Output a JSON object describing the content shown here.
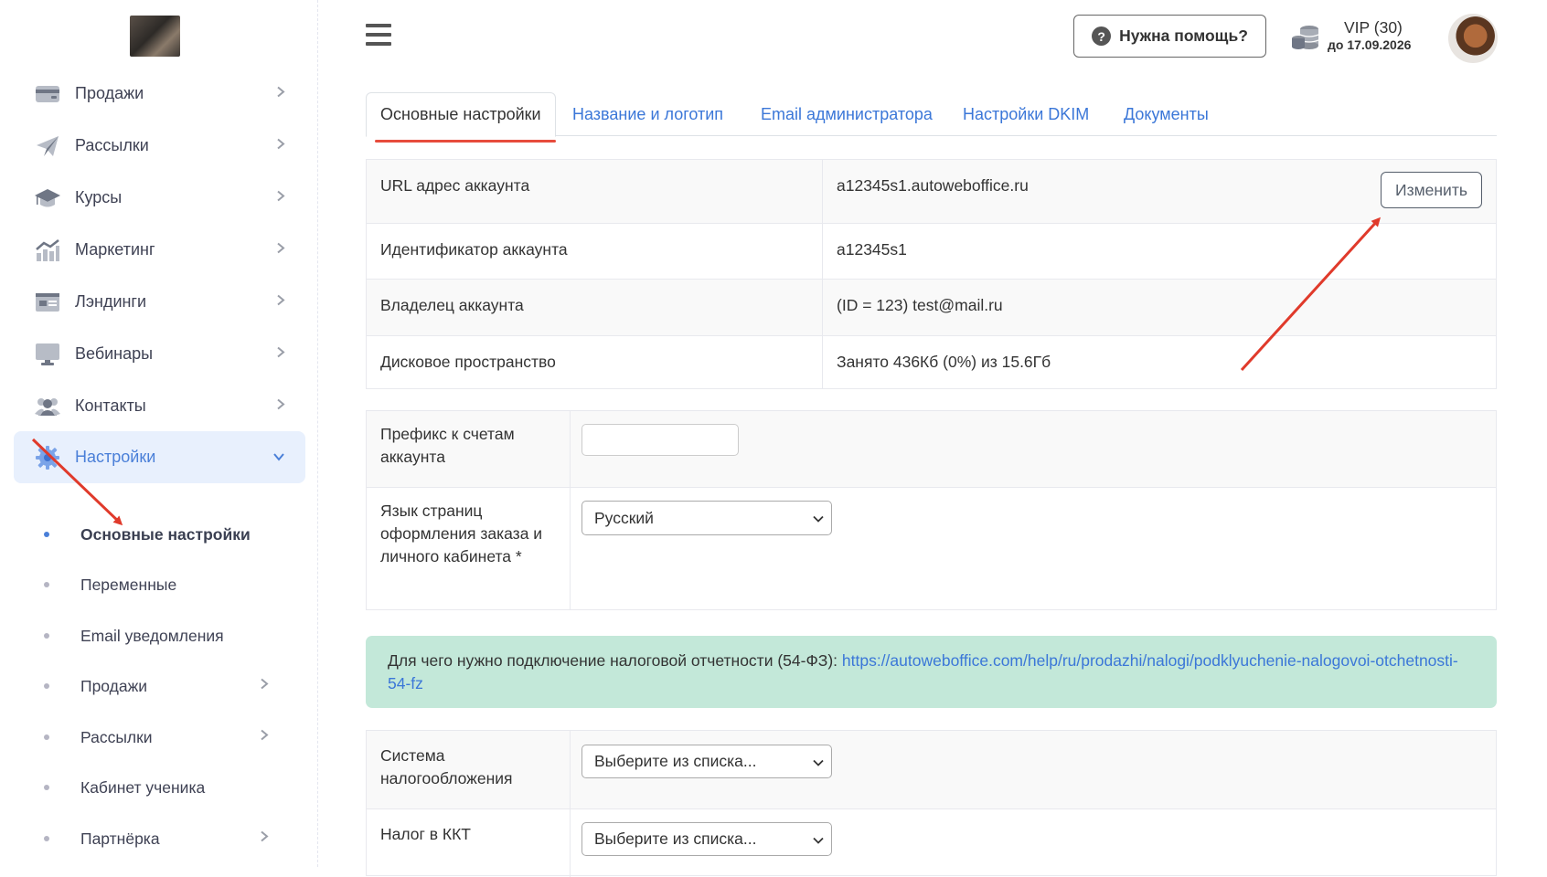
{
  "sidebar": {
    "items": [
      {
        "label": "Продажи",
        "icon": "wallet-icon"
      },
      {
        "label": "Рассылки",
        "icon": "paper-plane-icon"
      },
      {
        "label": "Курсы",
        "icon": "graduation-cap-icon"
      },
      {
        "label": "Маркетинг",
        "icon": "chart-icon"
      },
      {
        "label": "Лэндинги",
        "icon": "landing-icon"
      },
      {
        "label": "Вебинары",
        "icon": "monitor-icon"
      },
      {
        "label": "Контакты",
        "icon": "users-icon"
      },
      {
        "label": "Настройки",
        "icon": "gear-icon",
        "active": true
      }
    ],
    "sub_items": [
      {
        "label": "Основные настройки",
        "active": true
      },
      {
        "label": "Переменные"
      },
      {
        "label": "Email уведомления"
      },
      {
        "label": "Продажи",
        "has_children": true
      },
      {
        "label": "Рассылки",
        "has_children": true
      },
      {
        "label": "Кабинет ученика"
      },
      {
        "label": "Партнёрка",
        "has_children": true
      }
    ]
  },
  "header": {
    "help_label": "Нужна помощь?",
    "vip_title": "VIP (30)",
    "vip_date": "до 17.09.2026"
  },
  "tabs": [
    {
      "label": "Основные настройки",
      "active": true
    },
    {
      "label": "Название и логотип"
    },
    {
      "label": "Email администратора"
    },
    {
      "label": "Настройки DKIM"
    },
    {
      "label": "Документы"
    }
  ],
  "info": {
    "rows": [
      {
        "label": "URL адрес аккаунта",
        "value": "a12345s1.autoweboffice.ru"
      },
      {
        "label": "Идентификатор аккаунта",
        "value": "a12345s1"
      },
      {
        "label": "Владелец аккаунта",
        "value": "(ID = 123) test@mail.ru"
      },
      {
        "label": "Дисковое пространство",
        "value": "Занято 436Кб (0%) из 15.6Гб"
      }
    ],
    "edit_label": "Изменить"
  },
  "form1": {
    "prefix_label": "Префикс к счетам аккаунта",
    "prefix_value": "",
    "language_label": "Язык страниц оформления заказа и личного кабинета *",
    "language_value": "Русский"
  },
  "alert": {
    "text": "Для чего нужно подключение налоговой отчетности (54-ФЗ): ",
    "link": "https://autoweboffice.com/help/ru/prodazhi/nalogi/podklyuchenie-nalogovoi-otchetnosti-54-fz"
  },
  "form2": {
    "tax_system_label": "Система налогообложения",
    "tax_system_value": "Выберите из списка...",
    "kkt_tax_label": "Налог в ККТ",
    "kkt_tax_value": "Выберите из списка..."
  },
  "colors": {
    "accent": "#4a7fd8",
    "link": "#3b77d8",
    "arrow": "#e03a2b",
    "alert_bg": "#c3e8d9",
    "active_bg": "#e8f0fd"
  }
}
